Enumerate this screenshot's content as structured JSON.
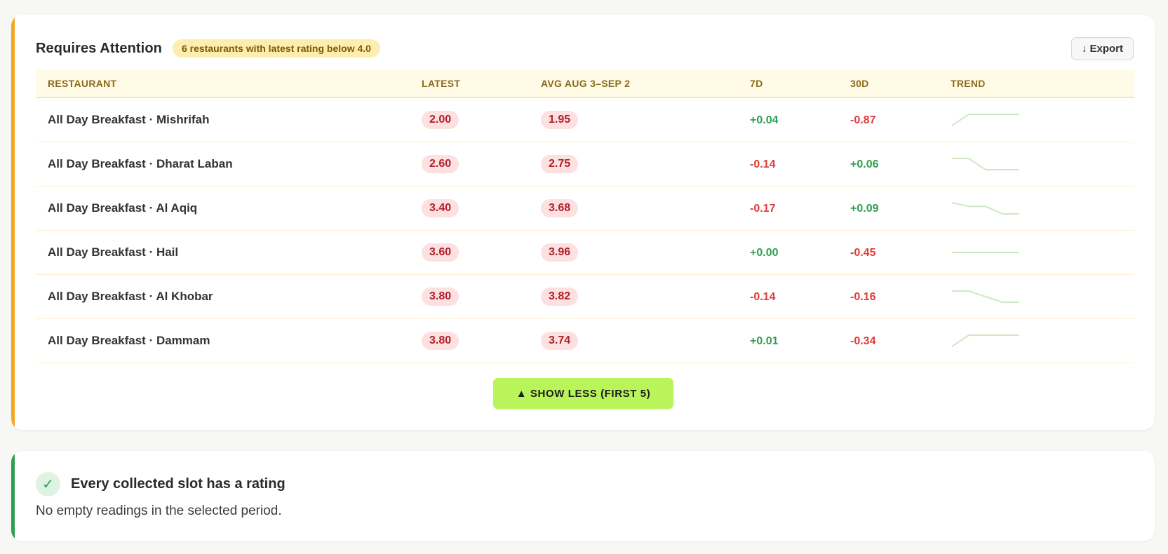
{
  "attention": {
    "title": "Requires Attention",
    "badge": "6 restaurants with latest rating below 4.0",
    "export_label": "↓ Export",
    "columns": [
      "RESTAURANT",
      "LATEST",
      "AVG AUG 3–SEP 2",
      "7D",
      "30D",
      "TREND"
    ],
    "rows": [
      {
        "name": "All Day Breakfast · Mishrifah",
        "latest": "2.00",
        "avg": "1.95",
        "d7": "+0.04",
        "d30": "-0.87",
        "trend": [
          1.9,
          2.0,
          2.0,
          2.0,
          2.0
        ]
      },
      {
        "name": "All Day Breakfast · Dharat Laban",
        "latest": "2.60",
        "avg": "2.75",
        "d7": "-0.14",
        "d30": "+0.06",
        "trend": [
          2.8,
          2.8,
          2.6,
          2.6,
          2.6
        ]
      },
      {
        "name": "All Day Breakfast · Al Aqiq",
        "latest": "3.40",
        "avg": "3.68",
        "d7": "-0.17",
        "d30": "+0.09",
        "trend": [
          3.7,
          3.6,
          3.6,
          3.4,
          3.4
        ]
      },
      {
        "name": "All Day Breakfast · Hail",
        "latest": "3.60",
        "avg": "3.96",
        "d7": "+0.00",
        "d30": "-0.45",
        "trend": [
          3.6,
          3.6,
          3.6,
          3.6,
          3.6
        ]
      },
      {
        "name": "All Day Breakfast · Al Khobar",
        "latest": "3.80",
        "avg": "3.82",
        "d7": "-0.14",
        "d30": "-0.16",
        "trend": [
          3.9,
          3.9,
          3.85,
          3.8,
          3.8
        ]
      },
      {
        "name": "All Day Breakfast · Dammam",
        "latest": "3.80",
        "avg": "3.74",
        "d7": "+0.01",
        "d30": "-0.34",
        "trend": [
          3.7,
          3.8,
          3.8,
          3.8,
          3.8
        ]
      }
    ],
    "show_less_label": "▲ SHOW LESS (FIRST 5)"
  },
  "status": {
    "check_icon": "✓",
    "title": "Every collected slot has a rating",
    "description": "No empty readings in the selected period."
  },
  "colors": {
    "attention_accent": "#f5a623",
    "ok_accent": "#2e9e4f",
    "positive": "#2e9e4f",
    "negative": "#e03a3a",
    "trend_line": "#cfe8c4",
    "button": "#b9f55a"
  }
}
